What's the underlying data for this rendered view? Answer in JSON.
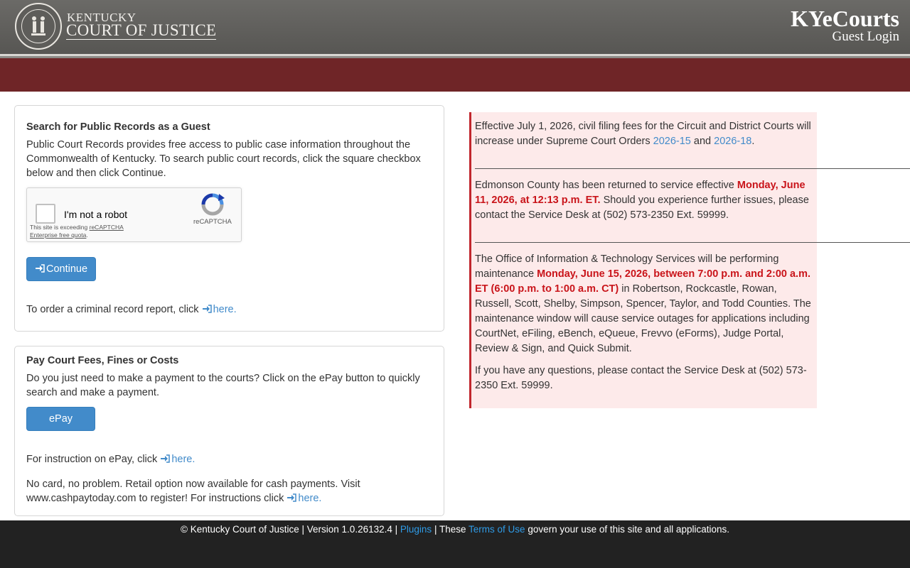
{
  "header": {
    "org_small": "KENTUCKY",
    "org_big": "COURT OF JUSTICE",
    "app_title": "KYeCourts",
    "app_subtitle": "Guest Login"
  },
  "guest_search": {
    "heading": "Search for Public Records as a Guest",
    "description": "Public Court Records provides free access to public case information throughout the Commonwealth of Kentucky. To search public court records, click the square checkbox below and then click Continue.",
    "captcha": {
      "label": "I'm not a robot",
      "brand": "reCAPTCHA",
      "note_prefix": "This site is exceeding ",
      "note_link": "reCAPTCHA Enterprise free quota",
      "note_suffix": "."
    },
    "continue_label": "Continue",
    "criminal_report_text": "To order a criminal record report, click",
    "criminal_report_link": "here."
  },
  "pay": {
    "heading": "Pay Court Fees, Fines or Costs",
    "description": "Do you just need to make a payment to the courts? Click on the ePay button to quickly search and make a payment.",
    "epay_label": "ePay",
    "instruction_text": "For instruction on ePay, click",
    "instruction_link": "here.",
    "cash_text": "No card, no problem. Retail option now available for cash payments. Visit www.cashpaytoday.com to register! For instructions click",
    "cash_link": "here."
  },
  "notices": {
    "n1_text": "Effective July 1, 2026, civil filing fees for the Circuit and District Courts will increase under Supreme Court Orders",
    "n1_link1": "2026-15",
    "n1_and": "and",
    "n1_link2": "2026-18",
    "n1_end": ".",
    "n2_text": "Edmonson County has been returned to service effective",
    "n2_bold": "Monday, June 11, 2026, at 12:13 p.m. ET.",
    "n2_rest": "Should you experience further issues, please contact the Service Desk at (502) 573-2350 Ext. 59999.",
    "n3_text": "The Office of Information & Technology Services will be performing maintenance",
    "n3_bold": "Monday, June 15, 2026, between 7:00 p.m. and 2:00 a.m. ET (6:00 p.m. to 1:00 a.m. CT)",
    "n3_rest": "in Robertson, Rockcastle, Rowan, Russell, Scott, Shelby, Simpson, Spencer, Taylor, and Todd Counties. The maintenance window will cause service outages for applications including CourtNet, eFiling, eBench, eQueue, Frevvo (eForms), Judge Portal, Review & Sign, and Quick Submit.",
    "n4_text": "If you have any questions, please contact the Service Desk at (502) 573-2350 Ext. 59999."
  },
  "footer": {
    "copyright": "© Kentucky Court of Justice | Version 1.0.26132.4 |",
    "plugins": "Plugins",
    "sep": "| These",
    "terms": "Terms of Use",
    "rest": "govern your use of this site and all applications."
  },
  "colors": {
    "accent": "#428bca",
    "alert_red": "#c9141a",
    "header_red": "#6f2527"
  }
}
